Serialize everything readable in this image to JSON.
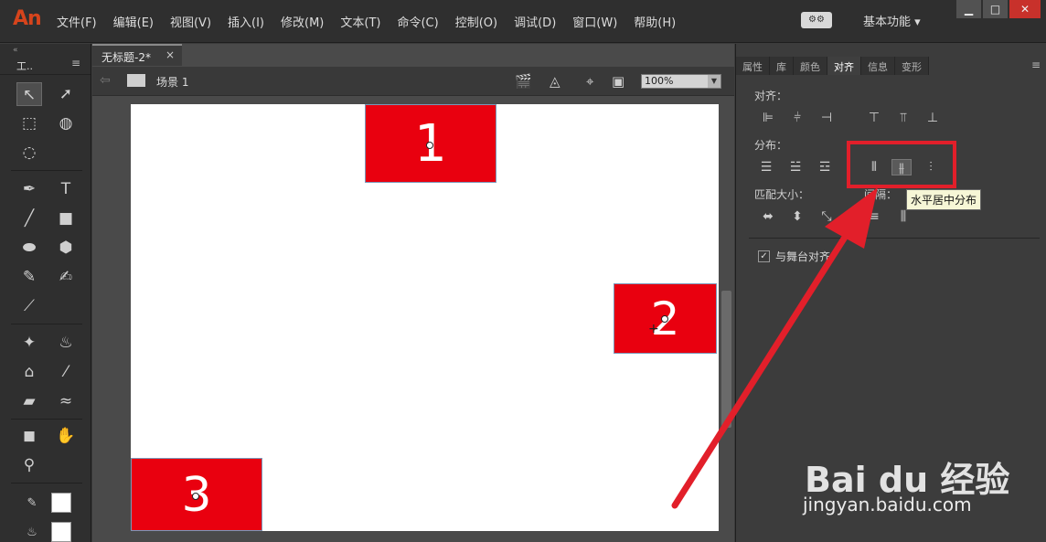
{
  "app": {
    "logo": "An"
  },
  "menu": {
    "items": [
      "文件(F)",
      "编辑(E)",
      "视图(V)",
      "插入(I)",
      "修改(M)",
      "文本(T)",
      "命令(C)",
      "控制(O)",
      "调试(D)",
      "窗口(W)",
      "帮助(H)"
    ],
    "workspace": "基本功能 ▾"
  },
  "tools_panel": {
    "title": "工..",
    "menu_icon": "hamburger-icon"
  },
  "document": {
    "tab_title": "无标题-2*",
    "scene": "场景 1",
    "zoom": "100%"
  },
  "stage": {
    "boxes": [
      {
        "label": "1",
        "color": "#e9000f"
      },
      {
        "label": "2",
        "color": "#e9000f"
      },
      {
        "label": "3",
        "color": "#e9000f"
      }
    ]
  },
  "right_panel": {
    "tabs": [
      "属性",
      "库",
      "颜色",
      "对齐",
      "信息",
      "变形"
    ],
    "active_tab": "对齐",
    "align_label": "对齐：",
    "distribute_label": "分布：",
    "match_size_label": "匹配大小：",
    "spacing_label": "间隔：",
    "tooltip": "水平居中分布",
    "align_to_stage": "与舞台对齐"
  },
  "annotation": {
    "highlight_color": "#e21f2a"
  },
  "watermark": {
    "brand": "Bai du 经验",
    "url": "jingyan.baidu.com"
  }
}
